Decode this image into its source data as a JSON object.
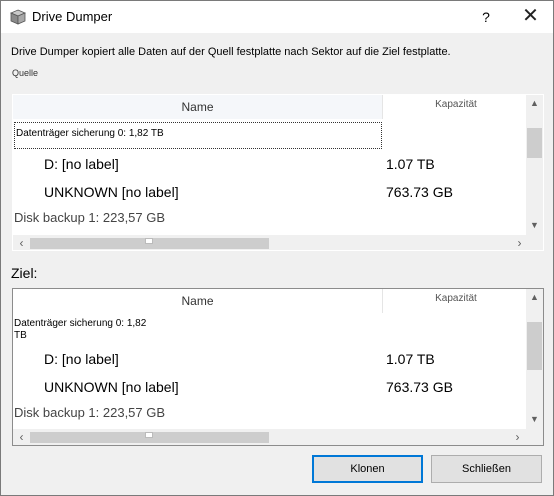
{
  "window": {
    "title": "Drive Dumper",
    "help_label": "?",
    "close_label": "✕"
  },
  "description": "Drive Dumper kopiert alle Daten auf der Quell festplatte nach Sektor auf die Ziel festplatte.",
  "source": {
    "label": "Quelle",
    "columns": {
      "name": "Name",
      "capacity": "Kapazität"
    },
    "group": "Datenträger sicherung 0: 1,82 TB",
    "rows": [
      {
        "name": "D: [no label]",
        "capacity": "1.07 TB"
      },
      {
        "name": "UNKNOWN [no label]",
        "capacity": "763.73 GB"
      }
    ],
    "disk1": "Disk backup 1: 223,57 GB"
  },
  "target": {
    "label": "Ziel:",
    "columns": {
      "name": "Name",
      "capacity": "Kapazität"
    },
    "group_line1": "Datenträger sicherung 0: 1,82",
    "group_line2": "TB",
    "rows": [
      {
        "name": "D: [no label]",
        "capacity": "1.07 TB"
      },
      {
        "name": "UNKNOWN [no label]",
        "capacity": "763.73 GB"
      }
    ],
    "disk1": "Disk backup 1: 223,57 GB"
  },
  "buttons": {
    "clone": "Klonen",
    "close": "Schließen"
  },
  "icons": {
    "app": "drive-box-icon",
    "scroll_up": "chevron-up-icon",
    "scroll_down": "chevron-down-icon",
    "scroll_left": "chevron-left-icon",
    "scroll_right": "chevron-right-icon"
  },
  "colors": {
    "focus_border": "#0078d7",
    "scroll_thumb": "#cdcdcd"
  }
}
